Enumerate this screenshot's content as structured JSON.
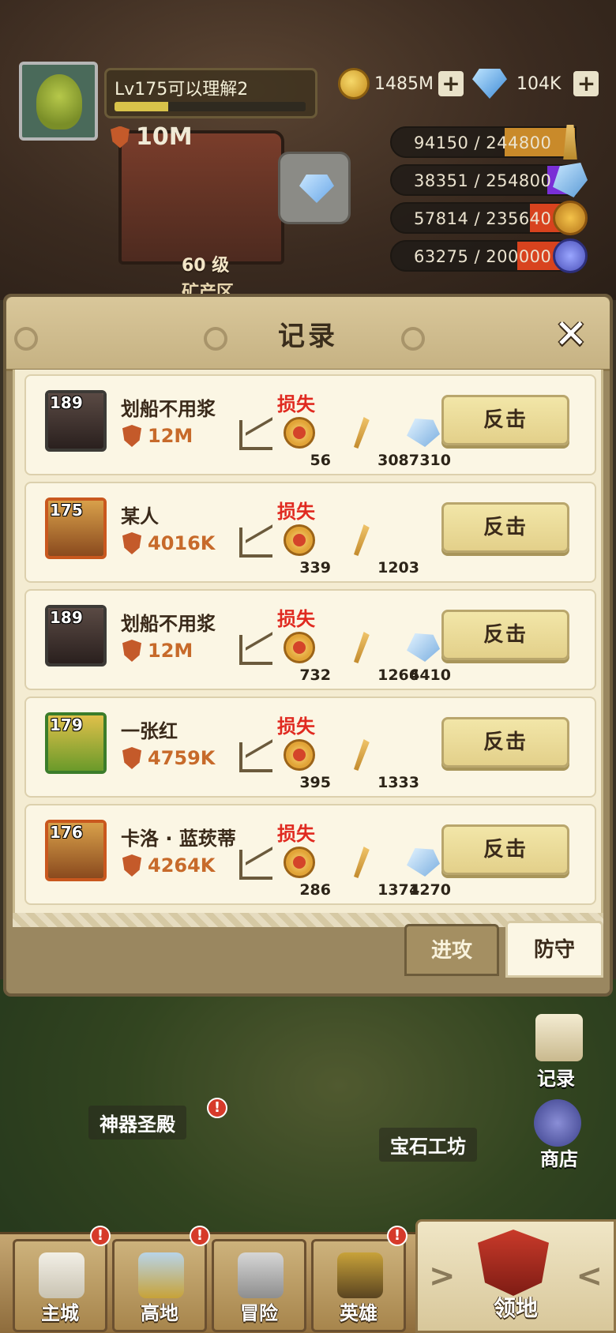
{
  "hud": {
    "player_name": "Lv175可以理解2",
    "xp_progress": 0.28,
    "power": "10M",
    "gold": "1485M",
    "diamonds": "104K",
    "resources": [
      {
        "text": "94150 / 244800",
        "icon": "wheat-icon",
        "fill": 0.385,
        "color": "#c98a2a"
      },
      {
        "text": "38351 / 254800",
        "icon": "crystal-icon",
        "fill": 0.151,
        "color": "#7a2fd6"
      },
      {
        "text": "57814 / 235640",
        "icon": "coin-icon",
        "fill": 0.245,
        "color": "#d8431e"
      },
      {
        "text": "63275 / 200000",
        "icon": "rune-icon",
        "fill": 0.316,
        "color": "#d8431e"
      }
    ]
  },
  "scene": {
    "mine_level": "60 级",
    "mine_area": "矿产区"
  },
  "dialog": {
    "title": "记录",
    "close_icon": "close-icon",
    "records": [
      {
        "level": "189",
        "name": "划船不用浆",
        "power": "12M",
        "status": "损失",
        "coin": "56",
        "wheat": "3087",
        "crystal": "310",
        "button": "反击",
        "frame": "dark"
      },
      {
        "level": "175",
        "name": "某人",
        "power": "4016K",
        "status": "损失",
        "coin": "339",
        "wheat": "1203",
        "crystal": "",
        "button": "反击",
        "frame": "orange"
      },
      {
        "level": "189",
        "name": "划船不用浆",
        "power": "12M",
        "status": "损失",
        "coin": "732",
        "wheat": "1266",
        "crystal": "4410",
        "button": "反击",
        "frame": "dark"
      },
      {
        "level": "179",
        "name": "一张红",
        "power": "4759K",
        "status": "损失",
        "coin": "395",
        "wheat": "1333",
        "crystal": "",
        "button": "反击",
        "frame": "green"
      },
      {
        "level": "176",
        "name": "卡洛 · 蓝莰蒂",
        "power": "4264K",
        "status": "损失",
        "coin": "286",
        "wheat": "1371",
        "crystal": "4270",
        "button": "反击",
        "frame": "orange"
      }
    ],
    "tabs": {
      "attack": "进攻",
      "defend": "防守"
    }
  },
  "map": {
    "artifact_hall": "神器圣殿",
    "gem_workshop": "宝石工坊",
    "record_btn": "记录",
    "shop_btn": "商店"
  },
  "nav": {
    "main_city": "主城",
    "highland": "高地",
    "adventure": "冒险",
    "hero": "英雄",
    "territory": "领地"
  }
}
